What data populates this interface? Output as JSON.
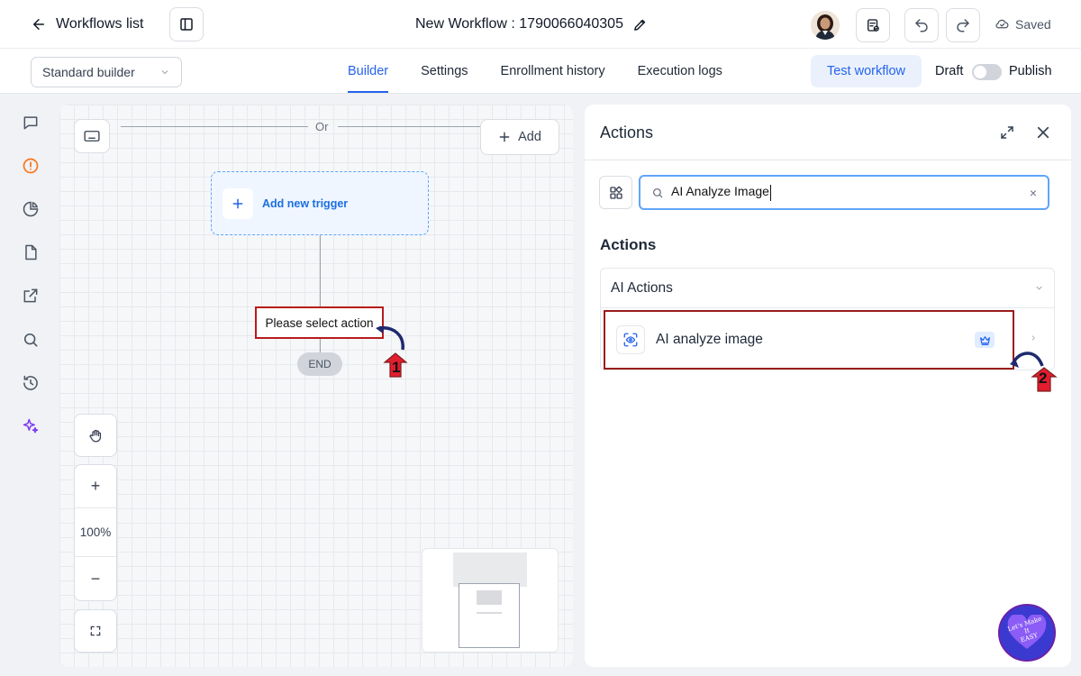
{
  "topbar": {
    "back_label": "Workflows list",
    "workflow_title": "New Workflow : 1790066040305",
    "saved_label": "Saved"
  },
  "subbar": {
    "builder_select_value": "Standard builder",
    "tabs": [
      {
        "label": "Builder",
        "active": true
      },
      {
        "label": "Settings",
        "active": false
      },
      {
        "label": "Enrollment history",
        "active": false
      },
      {
        "label": "Execution logs",
        "active": false
      }
    ],
    "test_workflow_label": "Test workflow",
    "draft_label": "Draft",
    "publish_label": "Publish",
    "publish_toggle_on": false
  },
  "rail": {
    "icons": [
      "chat-icon",
      "alert-circle-icon",
      "pie-chart-icon",
      "file-icon",
      "external-link-icon",
      "search-icon",
      "history-icon",
      "sparkles-icon"
    ]
  },
  "canvas": {
    "or_label": "Or",
    "add_label": "Add",
    "trigger_label": "Add new trigger",
    "action_placeholder": "Please select action",
    "end_label": "END",
    "zoom_level": "100%",
    "zoom_in": "+",
    "zoom_out": "−",
    "annotation_1": "1"
  },
  "panel": {
    "title": "Actions",
    "search_value": "AI Analyze Image",
    "search_clear": "×",
    "section_title": "Actions",
    "group_label": "AI Actions",
    "action_label": "AI analyze image",
    "annotation_2": "2"
  },
  "badge": {
    "line1": "Let's Make",
    "line2": "It",
    "line3": "EASY"
  },
  "colors": {
    "accent": "#2563eb",
    "annotation_red": "#b91c1c",
    "annotation_fill": "#e11d2e",
    "arrow_navy": "#1e2a6e",
    "trigger_border": "#60a5fa",
    "rail_active": "#f97316",
    "rail_sparkle": "#7c3aed"
  }
}
